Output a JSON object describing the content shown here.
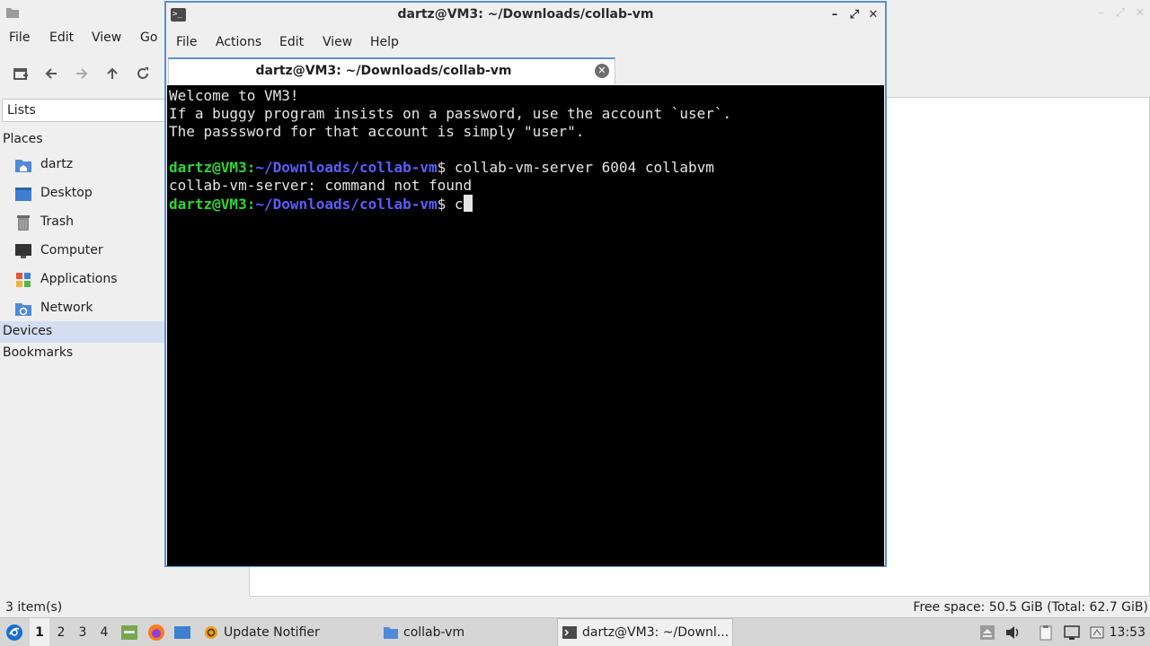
{
  "file_manager": {
    "menu": [
      "File",
      "Edit",
      "View",
      "Go"
    ],
    "side_combo": "Lists",
    "places_label": "Places",
    "places": [
      {
        "label": "dartz",
        "icon": "home-folder-icon"
      },
      {
        "label": "Desktop",
        "icon": "desktop-icon"
      },
      {
        "label": "Trash",
        "icon": "trash-icon"
      },
      {
        "label": "Computer",
        "icon": "computer-icon"
      },
      {
        "label": "Applications",
        "icon": "applications-icon"
      },
      {
        "label": "Network",
        "icon": "network-icon"
      }
    ],
    "devices_label": "Devices",
    "bookmarks_label": "Bookmarks",
    "status_left": "3 item(s)",
    "status_right": "Free space: 50.5 GiB (Total: 62.7 GiB)"
  },
  "terminal": {
    "title": "dartz@VM3: ~/Downloads/collab-vm",
    "menu": [
      "File",
      "Actions",
      "Edit",
      "View",
      "Help"
    ],
    "tab_label": "dartz@VM3: ~/Downloads/collab-vm",
    "lines": {
      "l1": "Welcome to VM3!",
      "l2": "If a buggy program insists on a password, use the account `user`.",
      "l3": "The passsword for that account is simply \"user\".",
      "prompt_user": "dartz@VM3",
      "prompt_sep": ":",
      "prompt_path": "~/Downloads/collab-vm",
      "prompt_end": "$ ",
      "cmd1": "collab-vm-server 6004 collabvm",
      "out1": "collab-vm-server: command not found",
      "cmd2": "c"
    },
    "colors": {
      "user": "#2ed534",
      "path": "#5c5cff",
      "bg": "#000000",
      "fg": "#e5e5e5"
    }
  },
  "taskbar": {
    "workspaces": [
      "1",
      "2",
      "3",
      "4"
    ],
    "active_workspace": "1",
    "tasks": [
      {
        "label": "Update Notifier",
        "icon": "update-notifier-icon"
      },
      {
        "label": "collab-vm",
        "icon": "folder-icon"
      },
      {
        "label": "dartz@VM3: ~/Downl...",
        "icon": "terminal-icon"
      }
    ],
    "clock": "13:53"
  }
}
